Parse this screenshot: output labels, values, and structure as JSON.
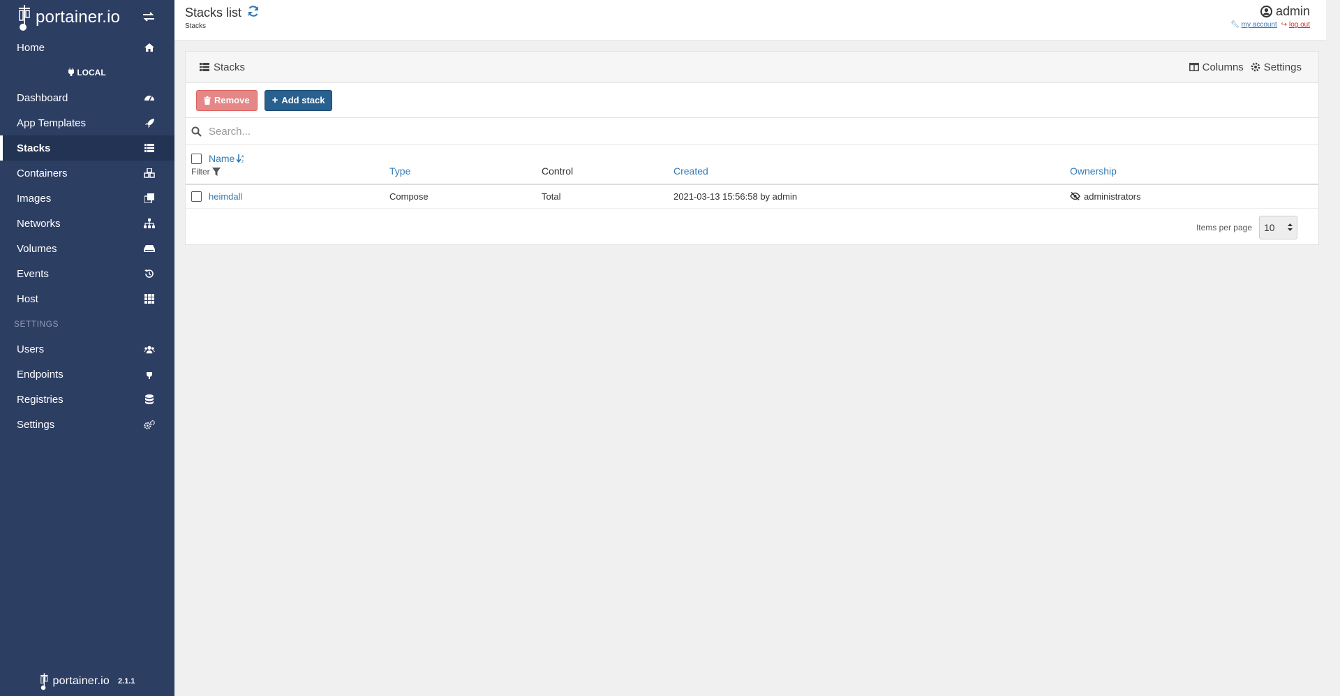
{
  "brand": {
    "name": "portainer.io",
    "version": "2.1.1"
  },
  "sidebar": {
    "home": "Home",
    "endpoint": "LOCAL",
    "items": [
      {
        "label": "Dashboard",
        "icon": "tachometer-icon"
      },
      {
        "label": "App Templates",
        "icon": "rocket-icon"
      },
      {
        "label": "Stacks",
        "icon": "th-list-icon",
        "active": true
      },
      {
        "label": "Containers",
        "icon": "cubes-icon"
      },
      {
        "label": "Images",
        "icon": "clone-icon"
      },
      {
        "label": "Networks",
        "icon": "sitemap-icon"
      },
      {
        "label": "Volumes",
        "icon": "hdd-icon"
      },
      {
        "label": "Events",
        "icon": "history-icon"
      },
      {
        "label": "Host",
        "icon": "th-icon"
      }
    ],
    "settings_heading": "SETTINGS",
    "settings_items": [
      {
        "label": "Users",
        "icon": "users-icon"
      },
      {
        "label": "Endpoints",
        "icon": "plug-icon"
      },
      {
        "label": "Registries",
        "icon": "database-icon"
      },
      {
        "label": "Settings",
        "icon": "cogs-icon"
      }
    ]
  },
  "header": {
    "title": "Stacks list",
    "breadcrumb": "Stacks",
    "username": "admin",
    "my_account": "my account",
    "log_out": "log out"
  },
  "widget": {
    "title": "Stacks",
    "columns_label": "Columns",
    "settings_label": "Settings",
    "remove_label": "Remove",
    "add_label": "Add stack",
    "search_placeholder": "Search...",
    "headers": {
      "name": "Name",
      "filter": "Filter",
      "type": "Type",
      "control": "Control",
      "created": "Created",
      "ownership": "Ownership"
    },
    "rows": [
      {
        "name": "heimdall",
        "type": "Compose",
        "control": "Total",
        "created": "2021-03-13 15:56:58 by admin",
        "ownership": "administrators"
      }
    ],
    "items_per_page_label": "Items per page",
    "items_per_page": "10"
  },
  "colors": {
    "sidebar_bg": "#2d3e63",
    "accent": "#337ab7",
    "danger": "#d9534f",
    "primary_btn": "#286090"
  }
}
